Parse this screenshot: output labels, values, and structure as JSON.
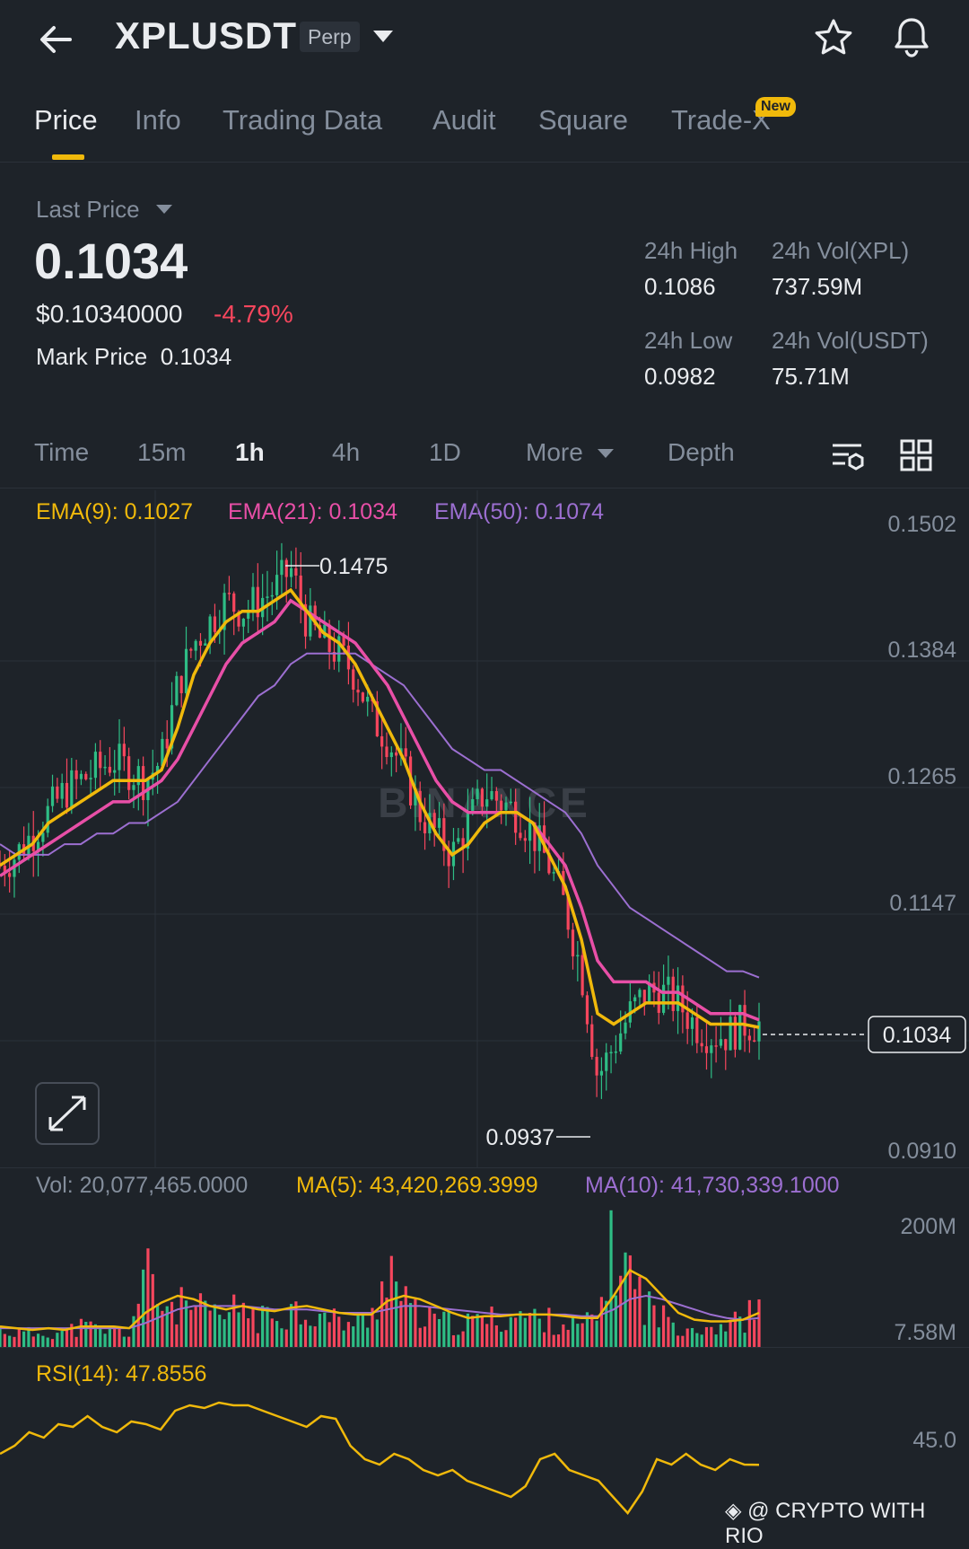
{
  "header": {
    "symbol": "XPLUSDT",
    "badge": "Perp",
    "icons": [
      "back-arrow-icon",
      "chevron-down-icon",
      "star-icon",
      "bell-icon"
    ]
  },
  "tabs": [
    {
      "label": "Price",
      "active": true
    },
    {
      "label": "Info"
    },
    {
      "label": "Trading Data"
    },
    {
      "label": "Audit"
    },
    {
      "label": "Square"
    },
    {
      "label": "Trade-X",
      "badge": "New"
    }
  ],
  "price": {
    "last_price_label": "Last Price",
    "last_price": "0.1034",
    "usd_price": "$0.10340000",
    "change": "-4.79%",
    "mark_label": "Mark Price",
    "mark_value": "0.1034"
  },
  "stats": {
    "high_label": "24h High",
    "high_value": "0.1086",
    "vol_base_label": "24h Vol(XPL)",
    "vol_base_value": "737.59M",
    "low_label": "24h Low",
    "low_value": "0.0982",
    "vol_quote_label": "24h Vol(USDT)",
    "vol_quote_value": "75.71M"
  },
  "intervals": {
    "time": "Time",
    "m15": "15m",
    "h1": "1h",
    "h4": "4h",
    "d1": "1D",
    "more": "More",
    "depth": "Depth",
    "active": "1h"
  },
  "indicators": {
    "ema9": "EMA(9): 0.1027",
    "ema21": "EMA(21): 0.1034",
    "ema50": "EMA(50): 0.1074",
    "vol": "Vol: 20,077,465.0000",
    "ma5": "MA(5): 43,420,269.3999",
    "ma10": "MA(10): 41,730,339.1000",
    "rsi": "RSI(14): 47.8556"
  },
  "colors": {
    "up": "#2ebd85",
    "down": "#f6465d",
    "ema9": "#f0b90b",
    "ema21": "#e84fa7",
    "ema50": "#9c6fd1",
    "accent": "#f0b90b"
  },
  "watermark": "BINANCE",
  "footer_credit": "@ CRYPTO WITH RIO",
  "chart_data": [
    {
      "type": "candlestick",
      "title": "",
      "y_ticks": [
        "0.1502",
        "0.1384",
        "0.1265",
        "0.1147",
        "0.1034",
        "0.0910"
      ],
      "ylim": [
        0.091,
        0.1502
      ],
      "last_price_tag": "0.1034",
      "high_marker": "0.1475",
      "low_marker": "0.0937",
      "close_path": [
        0.118,
        0.119,
        0.121,
        0.123,
        0.125,
        0.126,
        0.127,
        0.128,
        0.127,
        0.126,
        0.128,
        0.135,
        0.139,
        0.141,
        0.143,
        0.142,
        0.143,
        0.144,
        0.146,
        0.141,
        0.139,
        0.138,
        0.136,
        0.132,
        0.13,
        0.127,
        0.123,
        0.121,
        0.119,
        0.122,
        0.125,
        0.124,
        0.123,
        0.121,
        0.118,
        0.114,
        0.108,
        0.098,
        0.101,
        0.104,
        0.106,
        0.106,
        0.105,
        0.103,
        0.102,
        0.102,
        0.103,
        0.103
      ],
      "ema9": [
        0.118,
        0.119,
        0.12,
        0.122,
        0.123,
        0.124,
        0.125,
        0.126,
        0.126,
        0.126,
        0.127,
        0.131,
        0.136,
        0.139,
        0.141,
        0.142,
        0.142,
        0.143,
        0.144,
        0.142,
        0.14,
        0.139,
        0.137,
        0.134,
        0.131,
        0.128,
        0.124,
        0.121,
        0.119,
        0.12,
        0.122,
        0.123,
        0.123,
        0.122,
        0.119,
        0.116,
        0.111,
        0.104,
        0.103,
        0.104,
        0.105,
        0.105,
        0.105,
        0.104,
        0.103,
        0.103,
        0.103,
        0.1027
      ],
      "ema21": [
        0.117,
        0.118,
        0.119,
        0.12,
        0.121,
        0.122,
        0.123,
        0.124,
        0.124,
        0.125,
        0.126,
        0.128,
        0.131,
        0.134,
        0.137,
        0.139,
        0.14,
        0.141,
        0.143,
        0.142,
        0.141,
        0.14,
        0.139,
        0.137,
        0.135,
        0.132,
        0.129,
        0.126,
        0.124,
        0.123,
        0.123,
        0.123,
        0.123,
        0.122,
        0.12,
        0.118,
        0.114,
        0.109,
        0.107,
        0.107,
        0.107,
        0.106,
        0.106,
        0.105,
        0.104,
        0.104,
        0.104,
        0.1034
      ],
      "ema50": [
        0.12,
        0.119,
        0.119,
        0.119,
        0.12,
        0.12,
        0.121,
        0.121,
        0.122,
        0.122,
        0.123,
        0.124,
        0.126,
        0.128,
        0.13,
        0.132,
        0.134,
        0.135,
        0.137,
        0.138,
        0.138,
        0.138,
        0.138,
        0.137,
        0.136,
        0.135,
        0.133,
        0.131,
        0.129,
        0.128,
        0.127,
        0.127,
        0.126,
        0.125,
        0.124,
        0.123,
        0.121,
        0.118,
        0.116,
        0.114,
        0.113,
        0.112,
        0.111,
        0.11,
        0.109,
        0.108,
        0.108,
        0.1074
      ]
    },
    {
      "type": "bar",
      "title": "",
      "y_ticks": [
        "200M",
        "7.58M"
      ],
      "volume_path": [
        12,
        10,
        9,
        11,
        10,
        14,
        12,
        11,
        10,
        50,
        30,
        28,
        26,
        22,
        20,
        30,
        18,
        22,
        26,
        24,
        20,
        18,
        16,
        20,
        60,
        30,
        20,
        18,
        16,
        16,
        20,
        18,
        22,
        20,
        18,
        16,
        14,
        20,
        70,
        50,
        30,
        20,
        16,
        14,
        14,
        16,
        18,
        28
      ],
      "ma5": [
        12,
        11,
        10,
        11,
        10,
        12,
        12,
        12,
        11,
        20,
        26,
        30,
        28,
        24,
        22,
        24,
        22,
        21,
        23,
        24,
        22,
        20,
        19,
        19,
        27,
        30,
        28,
        24,
        20,
        17,
        18,
        18,
        19,
        19,
        19,
        18,
        17,
        17,
        30,
        45,
        40,
        30,
        20,
        16,
        15,
        15,
        16,
        20
      ],
      "ma10": [
        11,
        11,
        11,
        11,
        11,
        11,
        11,
        11,
        11,
        14,
        18,
        22,
        24,
        24,
        24,
        24,
        23,
        22,
        22,
        22,
        21,
        20,
        20,
        20,
        22,
        24,
        24,
        23,
        22,
        21,
        20,
        19,
        19,
        19,
        19,
        19,
        18,
        18,
        22,
        28,
        30,
        28,
        25,
        22,
        19,
        17,
        16,
        17
      ]
    },
    {
      "type": "line",
      "title": "",
      "y_ticks": [
        "45.0"
      ],
      "rsi14": [
        52,
        55,
        60,
        58,
        63,
        62,
        66,
        62,
        60,
        64,
        63,
        61,
        68,
        70,
        69,
        71,
        70,
        70,
        68,
        66,
        64,
        62,
        66,
        65,
        55,
        50,
        48,
        52,
        50,
        46,
        44,
        46,
        42,
        40,
        38,
        36,
        40,
        50,
        52,
        46,
        44,
        42,
        36,
        30,
        38,
        50,
        48,
        52,
        48,
        46,
        50,
        48,
        47.9
      ]
    }
  ]
}
